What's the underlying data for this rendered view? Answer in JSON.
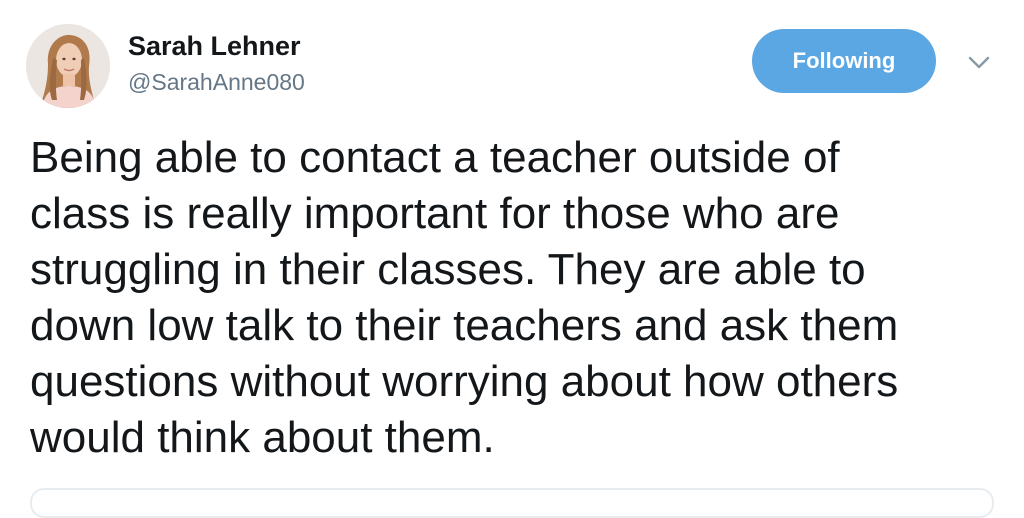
{
  "tweet": {
    "author": {
      "display_name": "Sarah Lehner",
      "handle": "@SarahAnne080",
      "avatar_icon": "profile-photo"
    },
    "follow_button_label": "Following",
    "menu_icon": "chevron-down-icon",
    "body": "Being able to contact a teacher outside of\nclass is really important for those who are\nstruggling in their classes.  They are able to\ndown low talk to their teachers and ask them\nquestions without worrying about how others\nwould think about them."
  },
  "colors": {
    "follow_button_bg": "#5ba7e4",
    "handle_text": "#657786",
    "body_text": "#14171a",
    "caret": "#8899a6"
  }
}
